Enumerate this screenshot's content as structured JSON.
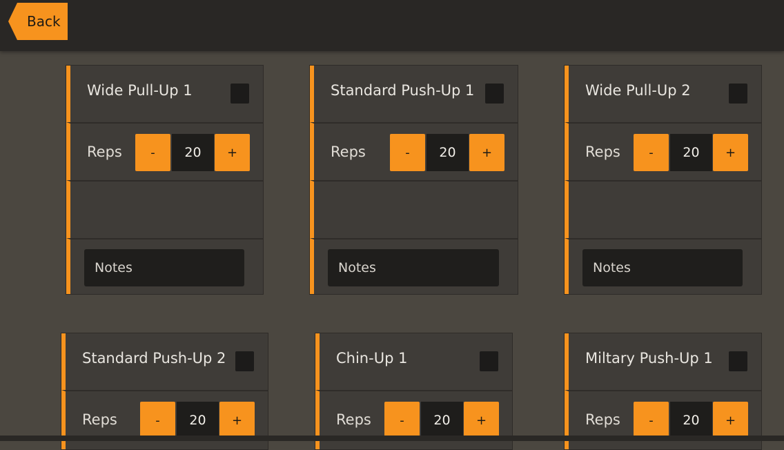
{
  "header": {
    "back_label": "Back"
  },
  "reps_label": "Reps",
  "minus_label": "-",
  "plus_label": "+",
  "notes_placeholder": "Notes",
  "colors": {
    "accent": "#f7931e",
    "card": "#3f3c38",
    "background": "#4b4740",
    "topbar": "#292725"
  },
  "exercises": [
    {
      "name": "Wide Pull-Up 1",
      "reps": "20",
      "checked": false
    },
    {
      "name": "Standard Push-Up 1",
      "reps": "20",
      "checked": false
    },
    {
      "name": "Wide Pull-Up 2",
      "reps": "20",
      "checked": false
    },
    {
      "name": "Standard Push-Up 2",
      "reps": "20",
      "checked": false
    },
    {
      "name": "Chin-Up 1",
      "reps": "20",
      "checked": false
    },
    {
      "name": "Miltary Push-Up 1",
      "reps": "20",
      "checked": false
    }
  ]
}
